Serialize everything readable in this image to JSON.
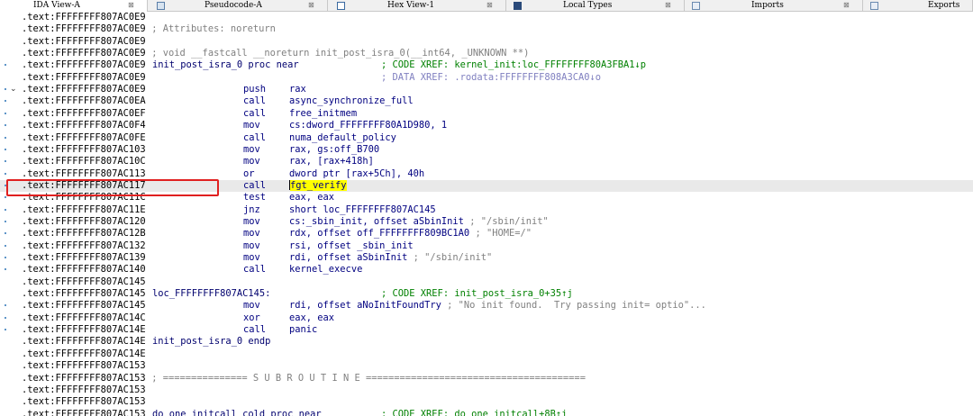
{
  "tabs": [
    {
      "label": "IDA View-A",
      "active": true,
      "icon": "ida-view-icon"
    },
    {
      "label": "Pseudocode-A",
      "active": false,
      "icon": "pseudocode-icon"
    },
    {
      "label": "Hex View-1",
      "active": false,
      "icon": "hex-view-icon"
    },
    {
      "label": "Local Types",
      "active": false,
      "icon": "local-types-icon"
    },
    {
      "label": "Imports",
      "active": false,
      "icon": "imports-icon"
    },
    {
      "label": "Exports",
      "active": false,
      "icon": "exports-icon"
    }
  ],
  "close_glyph": "⊠",
  "listing": [
    {
      "addr": ".text:FFFFFFFF807AC0E9"
    },
    {
      "addr": ".text:FFFFFFFF807AC0E9",
      "comment": "; Attributes: noreturn"
    },
    {
      "addr": ".text:FFFFFFFF807AC0E9"
    },
    {
      "addr": ".text:FFFFFFFF807AC0E9",
      "comment": "; void __fastcall __noreturn init_post_isra_0(__int64, _UNKNOWN **)"
    },
    {
      "addr": ".text:FFFFFFFF807AC0E9",
      "dot": true,
      "label": "init_post_isra_0 proc near",
      "xref": "; CODE XREF: kernel_init:loc_FFFFFFFF80A3FBA1↓p"
    },
    {
      "addr": ".text:FFFFFFFF807AC0E9",
      "dxref": "; DATA XREF: .rodata:FFFFFFFF808A3CA0↓o"
    },
    {
      "addr": ".text:FFFFFFFF807AC0E9",
      "dot": true,
      "chevron": true,
      "mnem": "push",
      "ops": "rax"
    },
    {
      "addr": ".text:FFFFFFFF807AC0EA",
      "dot": true,
      "mnem": "call",
      "ops": "async_synchronize_full"
    },
    {
      "addr": ".text:FFFFFFFF807AC0EF",
      "dot": true,
      "mnem": "call",
      "ops": "free_initmem"
    },
    {
      "addr": ".text:FFFFFFFF807AC0F4",
      "dot": true,
      "mnem": "mov",
      "ops": "cs:dword_FFFFFFFF80A1D980, 1"
    },
    {
      "addr": ".text:FFFFFFFF807AC0FE",
      "dot": true,
      "mnem": "call",
      "ops": "numa_default_policy"
    },
    {
      "addr": ".text:FFFFFFFF807AC103",
      "dot": true,
      "mnem": "mov",
      "ops": "rax, gs:off_B700"
    },
    {
      "addr": ".text:FFFFFFFF807AC10C",
      "dot": true,
      "mnem": "mov",
      "ops": "rax, [rax+418h]"
    },
    {
      "addr": ".text:FFFFFFFF807AC113",
      "dot": true,
      "mnem": "or",
      "ops": "dword ptr [rax+5Ch], 40h"
    },
    {
      "addr": ".text:FFFFFFFF807AC117",
      "dot": true,
      "highlight": true,
      "mnem": "call",
      "ops": "fgt_verify",
      "ops_highlight": true
    },
    {
      "addr": ".text:FFFFFFFF807AC11C",
      "dot": true,
      "mnem": "test",
      "ops": "eax, eax"
    },
    {
      "addr": ".text:FFFFFFFF807AC11E",
      "dot": true,
      "mnem": "jnz",
      "ops": "short loc_FFFFFFFF807AC145"
    },
    {
      "addr": ".text:FFFFFFFF807AC120",
      "dot": true,
      "mnem": "mov",
      "ops": "cs:_sbin_init, offset aSbinInit",
      "tail_comment": " ; \"/sbin/init\""
    },
    {
      "addr": ".text:FFFFFFFF807AC12B",
      "dot": true,
      "mnem": "mov",
      "ops": "rdx, offset off_FFFFFFFF809BC1A0",
      "tail_comment": " ; \"HOME=/\""
    },
    {
      "addr": ".text:FFFFFFFF807AC132",
      "dot": true,
      "mnem": "mov",
      "ops": "rsi, offset _sbin_init"
    },
    {
      "addr": ".text:FFFFFFFF807AC139",
      "dot": true,
      "mnem": "mov",
      "ops": "rdi, offset aSbinInit",
      "tail_comment": " ; \"/sbin/init\""
    },
    {
      "addr": ".text:FFFFFFFF807AC140",
      "dot": true,
      "mnem": "call",
      "ops": "kernel_execve"
    },
    {
      "addr": ".text:FFFFFFFF807AC145"
    },
    {
      "addr": ".text:FFFFFFFF807AC145",
      "label": "loc_FFFFFFFF807AC145:",
      "xref": "; CODE XREF: init_post_isra_0+35↑j"
    },
    {
      "addr": ".text:FFFFFFFF807AC145",
      "dot": true,
      "mnem": "mov",
      "ops": "rdi, offset aNoInitFoundTry",
      "tail_comment": " ; \"No init found.  Try passing init= optio\"..."
    },
    {
      "addr": ".text:FFFFFFFF807AC14C",
      "dot": true,
      "mnem": "xor",
      "ops": "eax, eax"
    },
    {
      "addr": ".text:FFFFFFFF807AC14E",
      "dot": true,
      "mnem": "call",
      "ops": "panic"
    },
    {
      "addr": ".text:FFFFFFFF807AC14E",
      "label": "init_post_isra_0 endp"
    },
    {
      "addr": ".text:FFFFFFFF807AC14E"
    },
    {
      "addr": ".text:FFFFFFFF807AC153"
    },
    {
      "addr": ".text:FFFFFFFF807AC153",
      "comment": "; =============== S U B R O U T I N E ======================================="
    },
    {
      "addr": ".text:FFFFFFFF807AC153"
    },
    {
      "addr": ".text:FFFFFFFF807AC153"
    },
    {
      "addr": ".text:FFFFFFFF807AC153",
      "label": "do_one_initcall_cold proc near",
      "xref": "; CODE XREF: do_one_initcall+8B↑j"
    }
  ],
  "colors": {
    "highlight_box": "#e02020",
    "symbol_highlight": "#ffff00",
    "gutter_dot": "#5f95c8"
  }
}
